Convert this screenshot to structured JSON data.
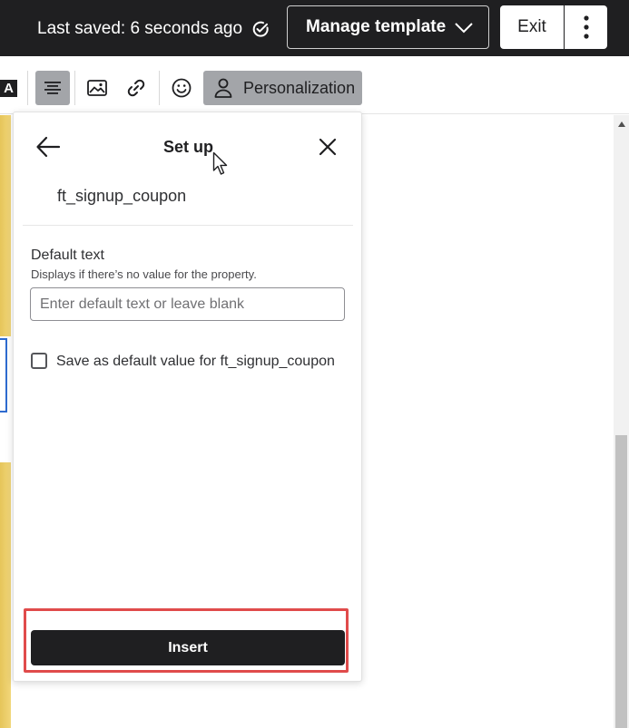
{
  "topbar": {
    "saved_text": "Last saved: 6 seconds ago",
    "manage_label": "Manage template",
    "exit_label": "Exit",
    "icons": {
      "saved": "check-circle-icon",
      "manage": "chevron-down-icon",
      "more": "more-vertical-icon"
    }
  },
  "toolbar": {
    "font_glyph": "A",
    "personalization_label": "Personalization",
    "icons": [
      "text-color-icon",
      "align-center-icon",
      "image-icon",
      "link-icon",
      "emoji-icon",
      "person-icon"
    ]
  },
  "panel": {
    "title": "Set up",
    "property_name": "ft_signup_coupon",
    "default_label": "Default text",
    "default_help": "Displays if there’s no value for the property.",
    "input_placeholder": "Enter default text or leave blank",
    "input_value": "",
    "checkbox_label": "Save as default value for ft_signup_coupon",
    "checkbox_checked": false,
    "insert_label": "Insert",
    "icons": {
      "back": "arrow-left-icon",
      "close": "close-icon"
    }
  },
  "colors": {
    "topbar_bg": "#1f1f21",
    "toolbar_active": "#a3a5a9",
    "highlight": "#e04b4b",
    "primary_button": "#1f1f21"
  }
}
